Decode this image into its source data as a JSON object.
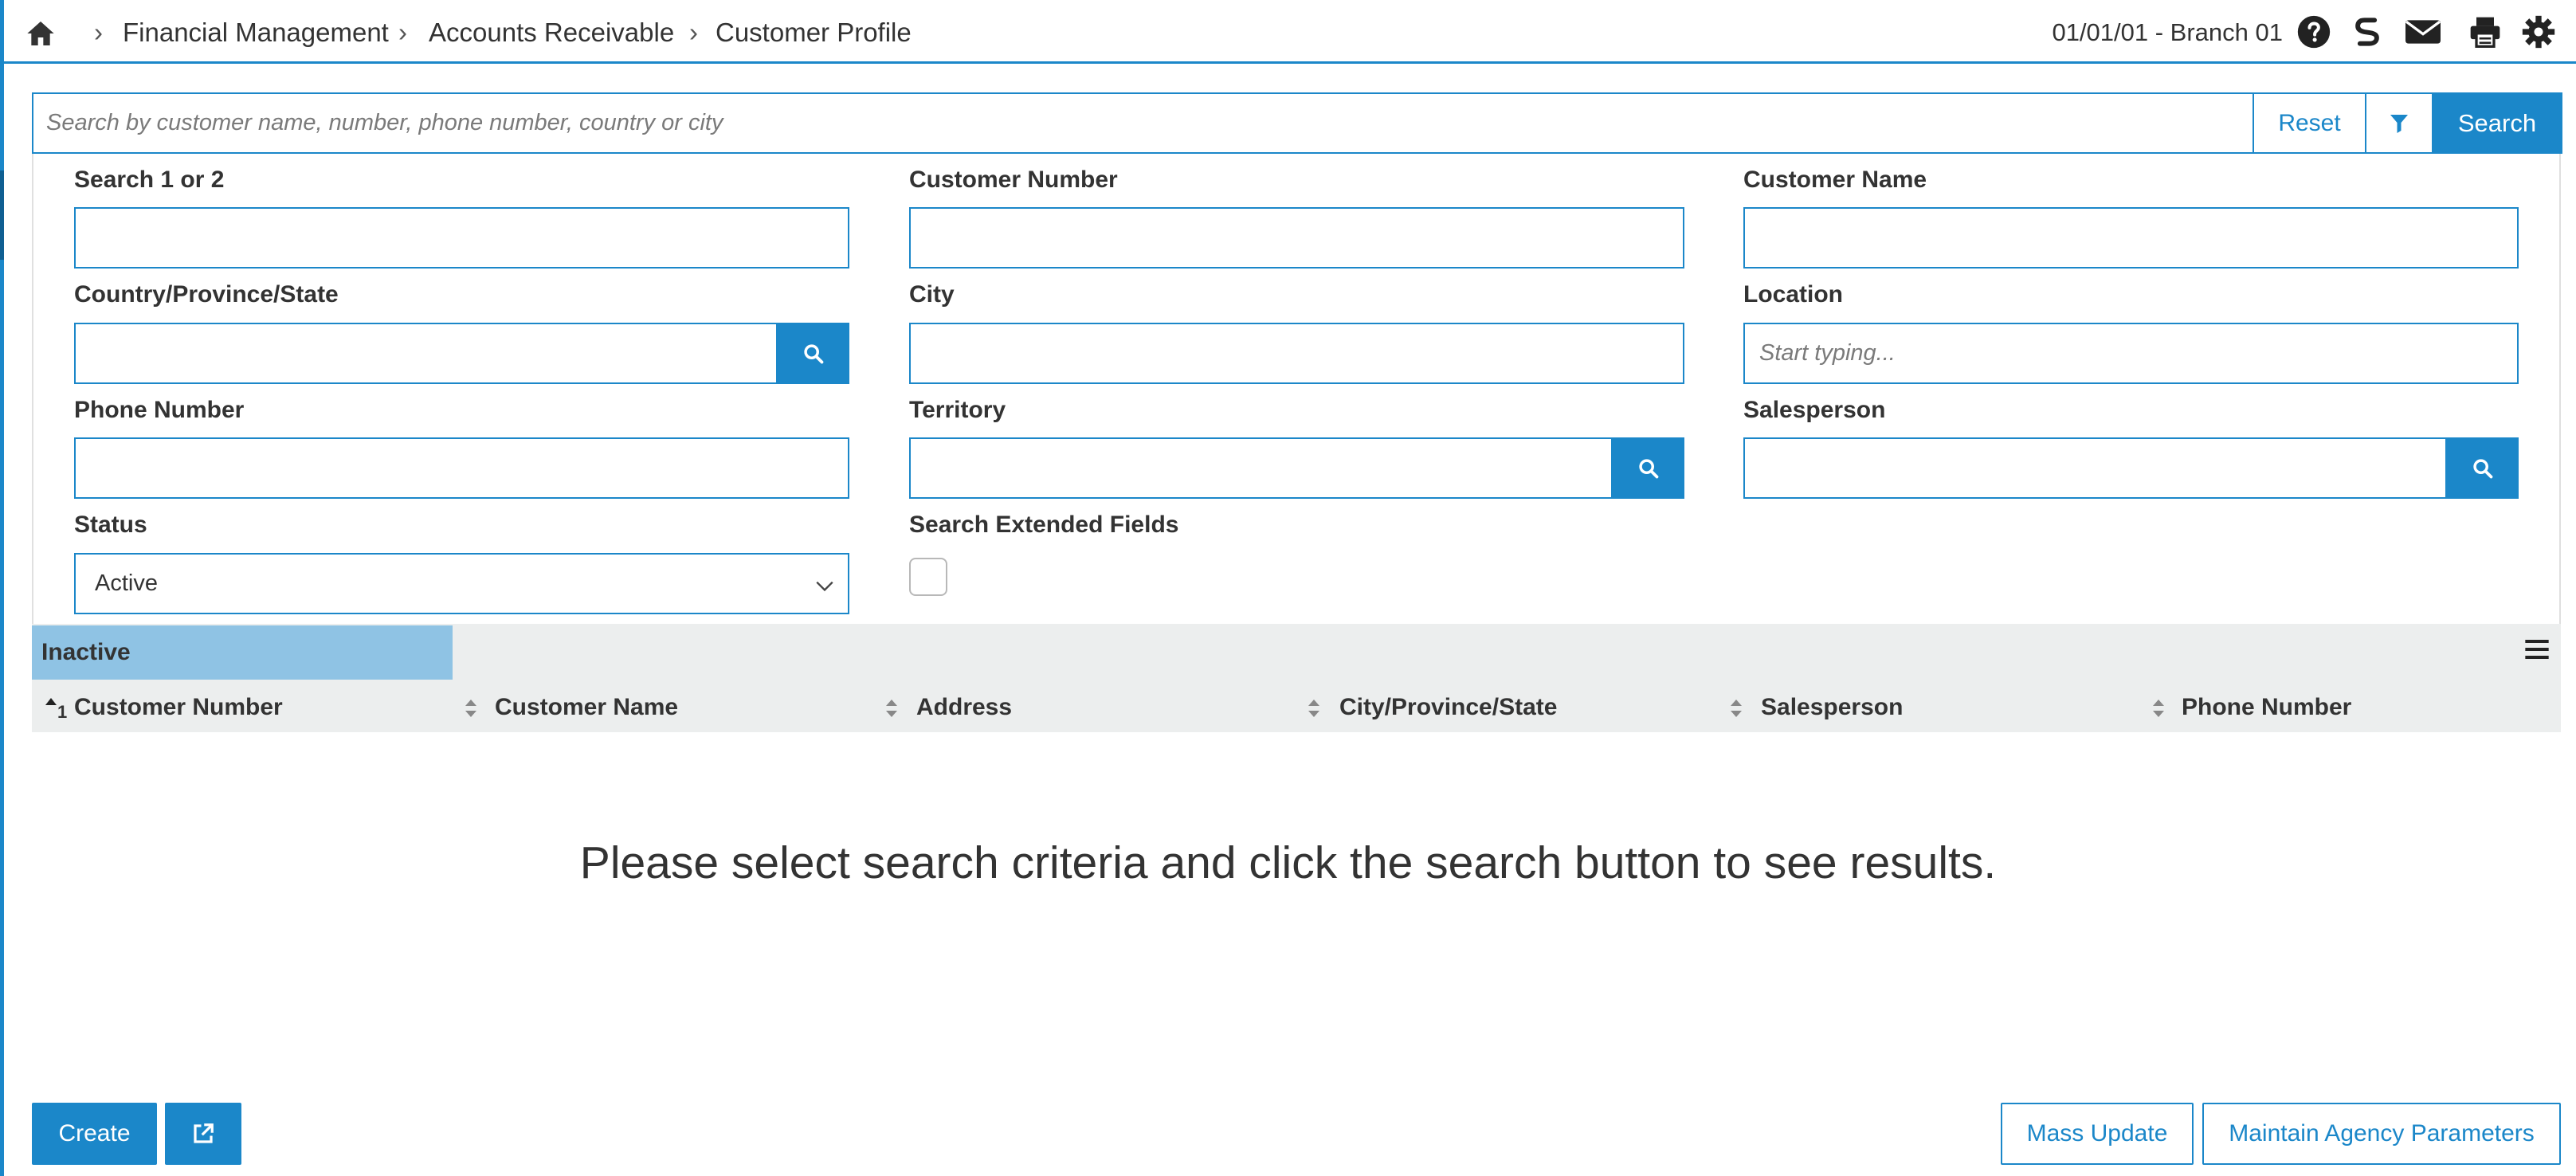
{
  "breadcrumb": {
    "items": [
      "Financial Management",
      "Accounts Receivable",
      "Customer Profile"
    ],
    "separator": "›"
  },
  "header": {
    "branch": "01/01/01 - Branch 01",
    "icons": [
      "help-icon",
      "s-logo-icon",
      "mail-icon",
      "print-icon",
      "gear-icon"
    ]
  },
  "search": {
    "placeholder": "Search by customer name, number, phone number, country or city",
    "reset_label": "Reset",
    "search_label": "Search"
  },
  "form": {
    "search12_label": "Search 1 or 2",
    "customer_number_label": "Customer Number",
    "customer_name_label": "Customer Name",
    "country_label": "Country/Province/State",
    "city_label": "City",
    "location_label": "Location",
    "location_placeholder": "Start typing...",
    "phone_label": "Phone Number",
    "territory_label": "Territory",
    "salesperson_label": "Salesperson",
    "status_label": "Status",
    "status_value": "Active",
    "extended_label": "Search Extended Fields",
    "extended_checked": false
  },
  "table": {
    "tab_label": "Inactive",
    "sort_index": "1",
    "columns": [
      "Customer Number",
      "Customer Name",
      "Address",
      "City/Province/State",
      "Salesperson",
      "Phone Number"
    ],
    "empty_message": "Please select search criteria and click the search button to see results."
  },
  "footer": {
    "create_label": "Create",
    "mass_update_label": "Mass Update",
    "agency_label": "Maintain Agency Parameters"
  },
  "colors": {
    "accent": "#1b87c9",
    "tab_active_bg": "#8fc3e4",
    "header_bg": "#eceeee"
  }
}
